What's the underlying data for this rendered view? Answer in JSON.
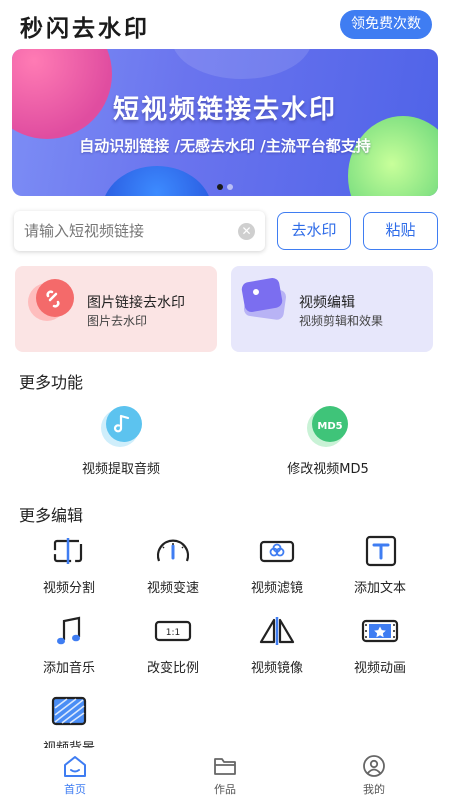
{
  "header": {
    "title": "秒闪去水印",
    "free_button": "领免费次数"
  },
  "banner": {
    "title": "短视频链接去水印",
    "subtitle": "自动识别链接 /无感去水印 /主流平台都支持",
    "active_dot": 0,
    "dot_count": 2
  },
  "search": {
    "placeholder": "请输入短视频链接",
    "value": "",
    "remove_button": "去水印",
    "paste_button": "粘贴"
  },
  "cards": [
    {
      "title": "图片链接去水印",
      "subtitle": "图片去水印"
    },
    {
      "title": "视频编辑",
      "subtitle": "视频剪辑和效果"
    }
  ],
  "more_functions": {
    "title": "更多功能",
    "items": [
      {
        "label": "视频提取音频",
        "icon": "music-note-icon",
        "badge": ""
      },
      {
        "label": "修改视频MD5",
        "icon": "md5-icon",
        "badge": "MD5"
      }
    ]
  },
  "more_edit": {
    "title": "更多编辑",
    "items": [
      {
        "label": "视频分割",
        "icon": "split-icon"
      },
      {
        "label": "视频变速",
        "icon": "speedometer-icon"
      },
      {
        "label": "视频滤镜",
        "icon": "filter-icon"
      },
      {
        "label": "添加文本",
        "icon": "text-icon"
      },
      {
        "label": "添加音乐",
        "icon": "music-icon"
      },
      {
        "label": "改变比例",
        "icon": "ratio-icon",
        "ratio": "1:1"
      },
      {
        "label": "视频镜像",
        "icon": "mirror-icon"
      },
      {
        "label": "视频动画",
        "icon": "animation-icon"
      },
      {
        "label": "视频背景",
        "icon": "background-icon"
      }
    ]
  },
  "tabs": [
    {
      "label": "首页",
      "icon": "home-icon",
      "active": true
    },
    {
      "label": "作品",
      "icon": "folder-icon",
      "active": false
    },
    {
      "label": "我的",
      "icon": "profile-icon",
      "active": false
    }
  ],
  "colors": {
    "accent": "#3f7df2",
    "card_pink": "#fbe4e4",
    "card_lavender": "#e7e7fb"
  }
}
